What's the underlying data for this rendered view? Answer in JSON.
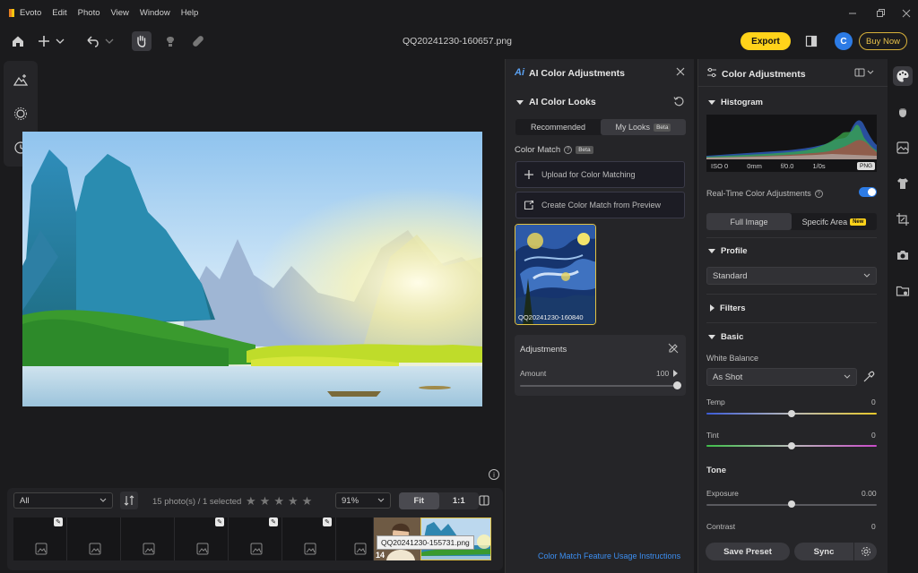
{
  "app": {
    "name": "Evoto",
    "menu": [
      "Evoto",
      "Edit",
      "Photo",
      "View",
      "Window",
      "Help"
    ]
  },
  "toolbar": {
    "filename": "QQ20241230-160657.png",
    "export_label": "Export",
    "avatar_letter": "C",
    "buy_label": "Buy Now"
  },
  "canvas": {
    "info_glyph": "i"
  },
  "filmstrip": {
    "filter_value": "All",
    "selection_text": "15 photo(s) / 1 selected",
    "zoom_value": "91%",
    "fit_label": "Fit",
    "one_to_one_label": "1:1",
    "tooltip": "QQ20241230-155731.png",
    "badge_count": "14"
  },
  "ai_panel": {
    "title": "AI Color Adjustments",
    "looks_title": "AI Color Looks",
    "tab_recommended": "Recommended",
    "tab_my_looks": "My Looks",
    "beta": "Beta",
    "color_match_label": "Color Match",
    "upload_label": "Upload for Color Matching",
    "create_label": "Create Color Match from Preview",
    "thumb_caption": "QQ20241230-160840",
    "adjustments_label": "Adjustments",
    "amount_label": "Amount",
    "amount_value": "100",
    "amount_fraction": 1.0,
    "usage_link": "Color Match Feature Usage Instructions"
  },
  "right_panel": {
    "title": "Color Adjustments",
    "histogram_title": "Histogram",
    "histogram_values": [
      "ISO 0",
      "0mm",
      "f/0.0",
      "1/0s"
    ],
    "png_badge": "PNG",
    "realtime_label": "Real-Time Color Adjustments",
    "realtime_on": true,
    "area_full": "Full Image",
    "area_specific": "Specifc Area",
    "new_badge": "New",
    "profile_title": "Profile",
    "profile_value": "Standard",
    "filters_title": "Filters",
    "basic_title": "Basic",
    "white_balance_label": "White Balance",
    "white_balance_value": "As Shot",
    "temp_label": "Temp",
    "temp_value": "0",
    "tint_label": "Tint",
    "tint_value": "0",
    "tone_title": "Tone",
    "exposure_label": "Exposure",
    "exposure_value": "0.00",
    "contrast_label": "Contrast",
    "contrast_value": "0",
    "save_preset_label": "Save Preset",
    "sync_label": "Sync"
  },
  "colors": {
    "accent_yellow": "#ffd31a",
    "accent_blue": "#2c7be5",
    "link_blue": "#3c8ef0",
    "bg": "#1b1b1d",
    "panel": "#252528"
  }
}
